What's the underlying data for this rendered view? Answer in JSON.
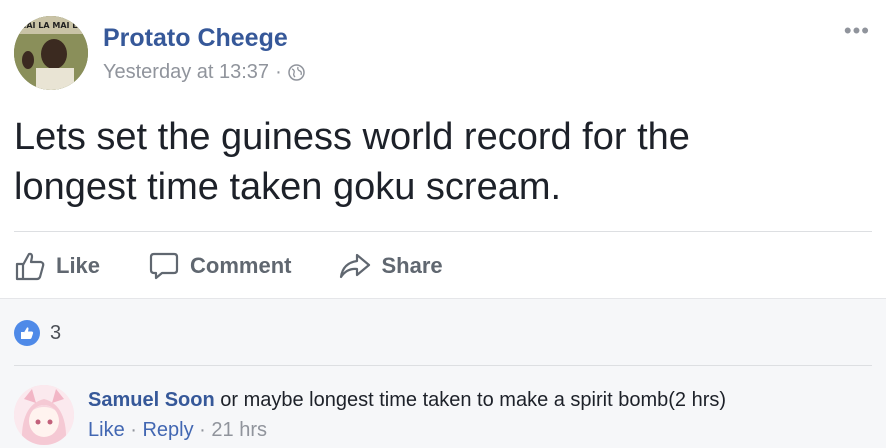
{
  "post": {
    "author": "Protato Cheege",
    "timestamp": "Yesterday at 13:37",
    "separator": "·",
    "privacy_icon": "globe-icon",
    "more_label": "•••",
    "avatar_caption": "MAI LA MAI LA",
    "text_line1": "Lets set the guiness world record for the",
    "text_line2": "longest time taken goku scream."
  },
  "actions": {
    "like_label": "Like",
    "comment_label": "Comment",
    "share_label": "Share"
  },
  "reactions": {
    "icon": "like-reaction-icon",
    "count": "3"
  },
  "comment": {
    "author": "Samuel Soon",
    "text": " or maybe longest time taken to make a spirit bomb(2 hrs)",
    "like_label": "Like",
    "dot": " · ",
    "reply_label": "Reply",
    "time": "21 hrs"
  },
  "colors": {
    "link_blue": "#365899",
    "accent_blue": "#4267b2",
    "reaction_blue": "#4f8ae8",
    "muted": "#90949c",
    "action_grey": "#606770",
    "comments_bg": "#f6f7f9"
  }
}
